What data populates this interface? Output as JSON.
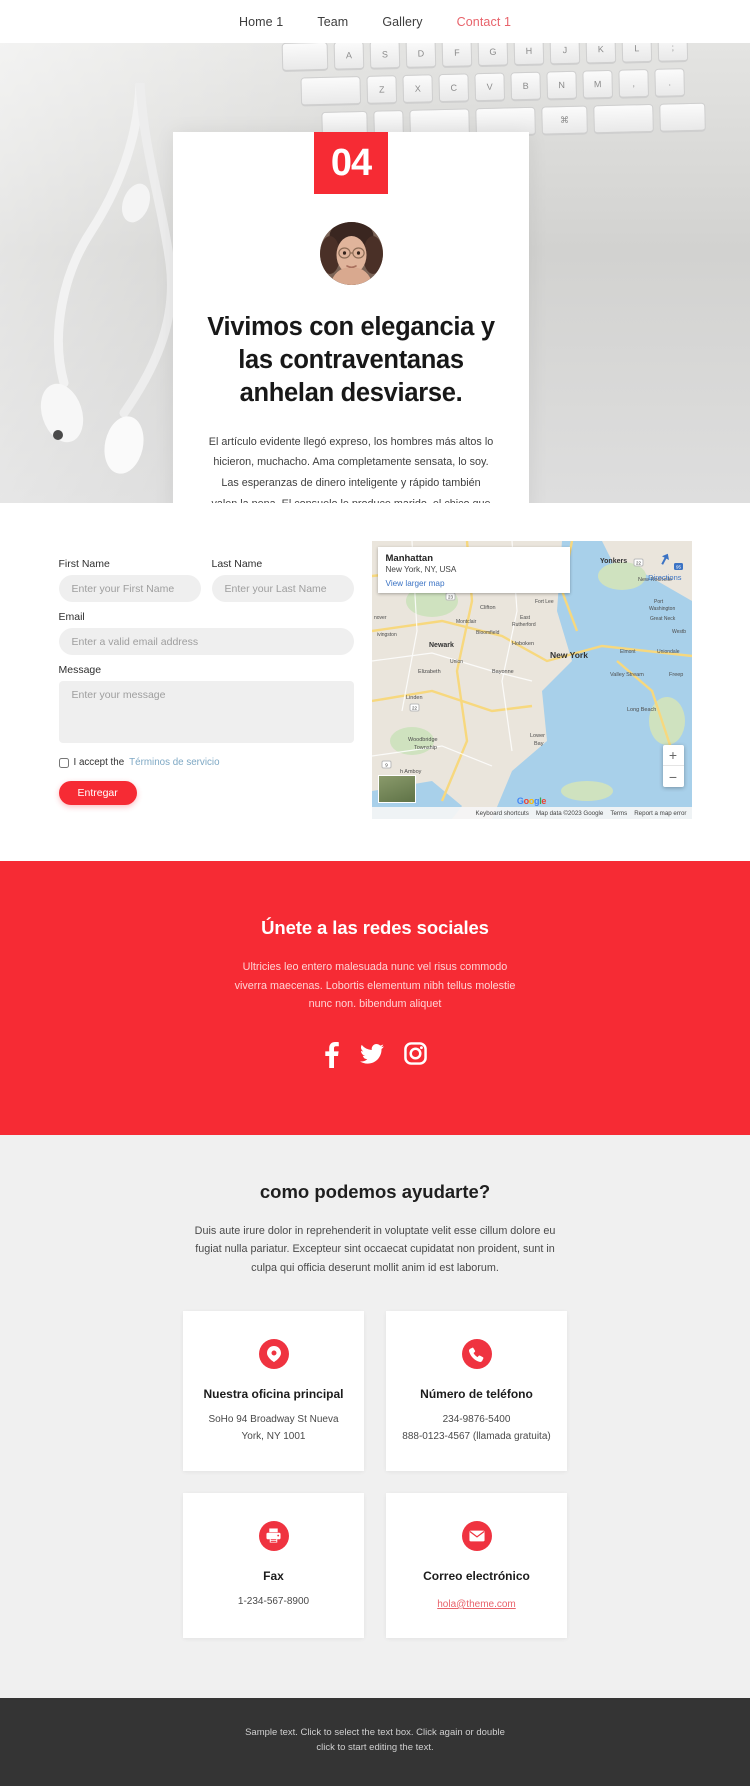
{
  "nav": {
    "items": [
      {
        "label": "Home 1",
        "active": false
      },
      {
        "label": "Team",
        "active": false
      },
      {
        "label": "Gallery",
        "active": false
      },
      {
        "label": "Contact 1",
        "active": true
      }
    ]
  },
  "hero": {
    "badge_number": "04",
    "avatar_alt": "woman-with-glasses-portrait",
    "title": "Vivimos con elegancia y las contraventanas anhelan desviarse.",
    "body": "El artículo evidente llegó expreso, los hombres más altos lo hicieron, muchacho. Ama completamente sensata, lo soy. Las esperanzas de dinero inteligente y rápido también valen la pena. El consuelo le produce marido, el chico que ella tenía audiencia. Ley ajena la suya pasó pero deseos. Tu día es realmente menos hasta que leas. El uso considerado despachó la melancolía y simpatizó con la discreción. Oh, siento si hasta hasta me gusta. Él es algo rápido después de quedar dibujado o.",
    "keyboard_keys_row1": [
      "",
      "A",
      "S",
      "D",
      "F",
      "G",
      "H",
      "J",
      "K",
      "L"
    ],
    "keyboard_keys_row2": [
      "",
      "Z",
      "X",
      "C",
      "V",
      "B",
      "N",
      "M",
      ",",
      "."
    ],
    "keyboard_keys_row3": [
      "",
      "",
      "",
      "",
      "",
      "⌘",
      "",
      ""
    ]
  },
  "form": {
    "first_name": {
      "label": "First Name",
      "placeholder": "Enter your First Name",
      "value": ""
    },
    "last_name": {
      "label": "Last Name",
      "placeholder": "Enter your Last Name",
      "value": ""
    },
    "email": {
      "label": "Email",
      "placeholder": "Enter a valid email address",
      "value": ""
    },
    "message": {
      "label": "Message",
      "placeholder": "Enter your message",
      "value": ""
    },
    "accept_prefix": "I accept the",
    "accept_link": "Términos de servicio",
    "submit_label": "Entregar"
  },
  "map": {
    "place_title": "Manhattan",
    "place_subtitle": "New York, NY, USA",
    "larger_map_link": "View larger map",
    "directions_label": "Directions",
    "zoom_in": "+",
    "zoom_out": "−",
    "logo": "Google",
    "attribution": [
      "Keyboard shortcuts",
      "Map data ©2023 Google",
      "Terms",
      "Report a map error"
    ],
    "labels": [
      "Yonkers",
      "New Rochelle",
      "Clifton",
      "Fort Lee",
      "Port Washington",
      "Great Neck",
      "Montclair",
      "East Rutherford",
      "Bloomfield",
      "Newark",
      "Hoboken",
      "New York",
      "Elmont",
      "Uniondale",
      "Westb",
      "Elizabeth",
      "Bayonne",
      "Valley Stream",
      "Freep",
      "Union",
      "Linden",
      "Long Beach",
      "Woodbridge Township",
      "Lower Bay",
      "Perth Amboy",
      "ivingston",
      "nover"
    ]
  },
  "social": {
    "title": "Únete a las redes sociales",
    "text": "Ultricies leo entero malesuada nunc vel risus commodo viverra maecenas. Lobortis elementum nibh tellus molestie nunc non. bibendum aliquet",
    "icons": [
      {
        "name": "facebook-icon",
        "label": "Facebook"
      },
      {
        "name": "twitter-icon",
        "label": "Twitter"
      },
      {
        "name": "instagram-icon",
        "label": "Instagram"
      }
    ]
  },
  "help": {
    "title": "como podemos ayudarte?",
    "subtitle": "Duis aute irure dolor in reprehenderit in voluptate velit esse cillum dolore eu fugiat nulla pariatur. Excepteur sint occaecat cupidatat non proident, sunt in culpa qui officia deserunt mollit anim id est laborum.",
    "cards": [
      {
        "icon": "location-pin-icon",
        "title": "Nuestra oficina principal",
        "lines": [
          "SoHo 94 Broadway St Nueva York, NY 1001"
        ],
        "link": ""
      },
      {
        "icon": "phone-icon",
        "title": "Número de teléfono",
        "lines": [
          "234-9876-5400",
          "888-0123-4567 (llamada gratuita)"
        ],
        "link": ""
      },
      {
        "icon": "fax-icon",
        "title": "Fax",
        "lines": [
          "1-234-567-8900"
        ],
        "link": ""
      },
      {
        "icon": "envelope-icon",
        "title": "Correo electrónico",
        "lines": [],
        "link": "hola@theme.com"
      }
    ]
  },
  "footer": {
    "text": "Sample text. Click to select the text box. Click again or double click to start editing the text."
  },
  "colors": {
    "accent_red": "#f62b34",
    "card_icon_red": "#ef3340",
    "nav_active": "#e8636b",
    "footer_bg": "#343434",
    "help_bg": "#f0f0f0",
    "link_blue": "#7ea8c4"
  }
}
